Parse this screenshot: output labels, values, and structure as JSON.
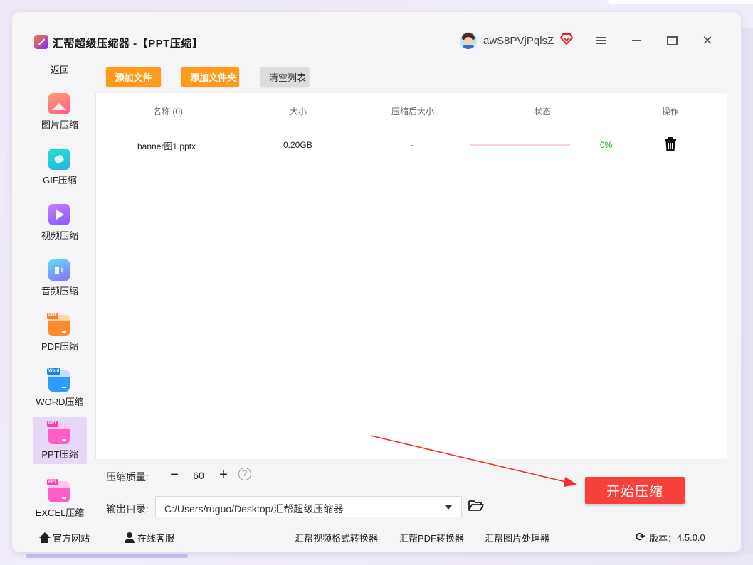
{
  "window": {
    "title": "汇帮超级压缩器 -【PPT压缩】",
    "username": "awS8PVjPqlsZ",
    "menu_icon": "hamburger-menu-icon",
    "minimize_icon": "minimize-icon",
    "maximize_icon": "maximize-icon",
    "close_label": "✕"
  },
  "sidebar": {
    "back_label": "返回",
    "items": [
      {
        "label": "图片压缩",
        "icon": "image-compress-icon"
      },
      {
        "label": "GIF压缩",
        "icon": "gif-compress-icon"
      },
      {
        "label": "视频压缩",
        "icon": "video-compress-icon"
      },
      {
        "label": "音频压缩",
        "icon": "audio-compress-icon"
      },
      {
        "label": "PDF压缩",
        "icon": "pdf-compress-icon",
        "tag": "PDF"
      },
      {
        "label": "WORD压缩",
        "icon": "word-compress-icon",
        "tag": "Word"
      },
      {
        "label": "PPT压缩",
        "icon": "ppt-compress-icon",
        "tag": "PPT",
        "active": true
      },
      {
        "label": "EXCEL压缩",
        "icon": "excel-compress-icon",
        "tag": "PPT"
      }
    ]
  },
  "toolbar": {
    "add_file": "添加文件",
    "add_folder": "添加文件夹",
    "clear_list": "清空列表"
  },
  "table": {
    "headers": {
      "name": "名称 (0)",
      "size": "大小",
      "compressed_size": "压缩后大小",
      "status": "状态",
      "action": "操作"
    },
    "rows": [
      {
        "name": "banner图1.pptx",
        "size": "0.20GB",
        "compressed_size": "-",
        "progress_percent": 0,
        "progress_label": "0%",
        "action_icon": "trash-icon"
      }
    ]
  },
  "settings": {
    "quality_label": "压缩质量:",
    "quality_minus": "−",
    "quality_value": "60",
    "quality_plus": "+",
    "quality_help": "?",
    "output_label": "输出目录:",
    "output_path": "C:/Users/ruguo/Desktop/汇帮超级压缩器"
  },
  "start_button": "开始压缩",
  "footer": {
    "website": "官方网站",
    "support": "在线客服",
    "link1": "汇帮视频格式转换器",
    "link2": "汇帮PDF转换器",
    "link3": "汇帮图片处理器",
    "version_label": "版本：",
    "version": "4.5.0.0"
  },
  "colors": {
    "orange_button": "#ff9a1a",
    "start_button": "#f8413a",
    "active_sidebar": "#e8d8f7",
    "progress_track": "#f9cfe0",
    "percent_text": "#2aa02a",
    "annotation_arrow": "#f0302a"
  }
}
